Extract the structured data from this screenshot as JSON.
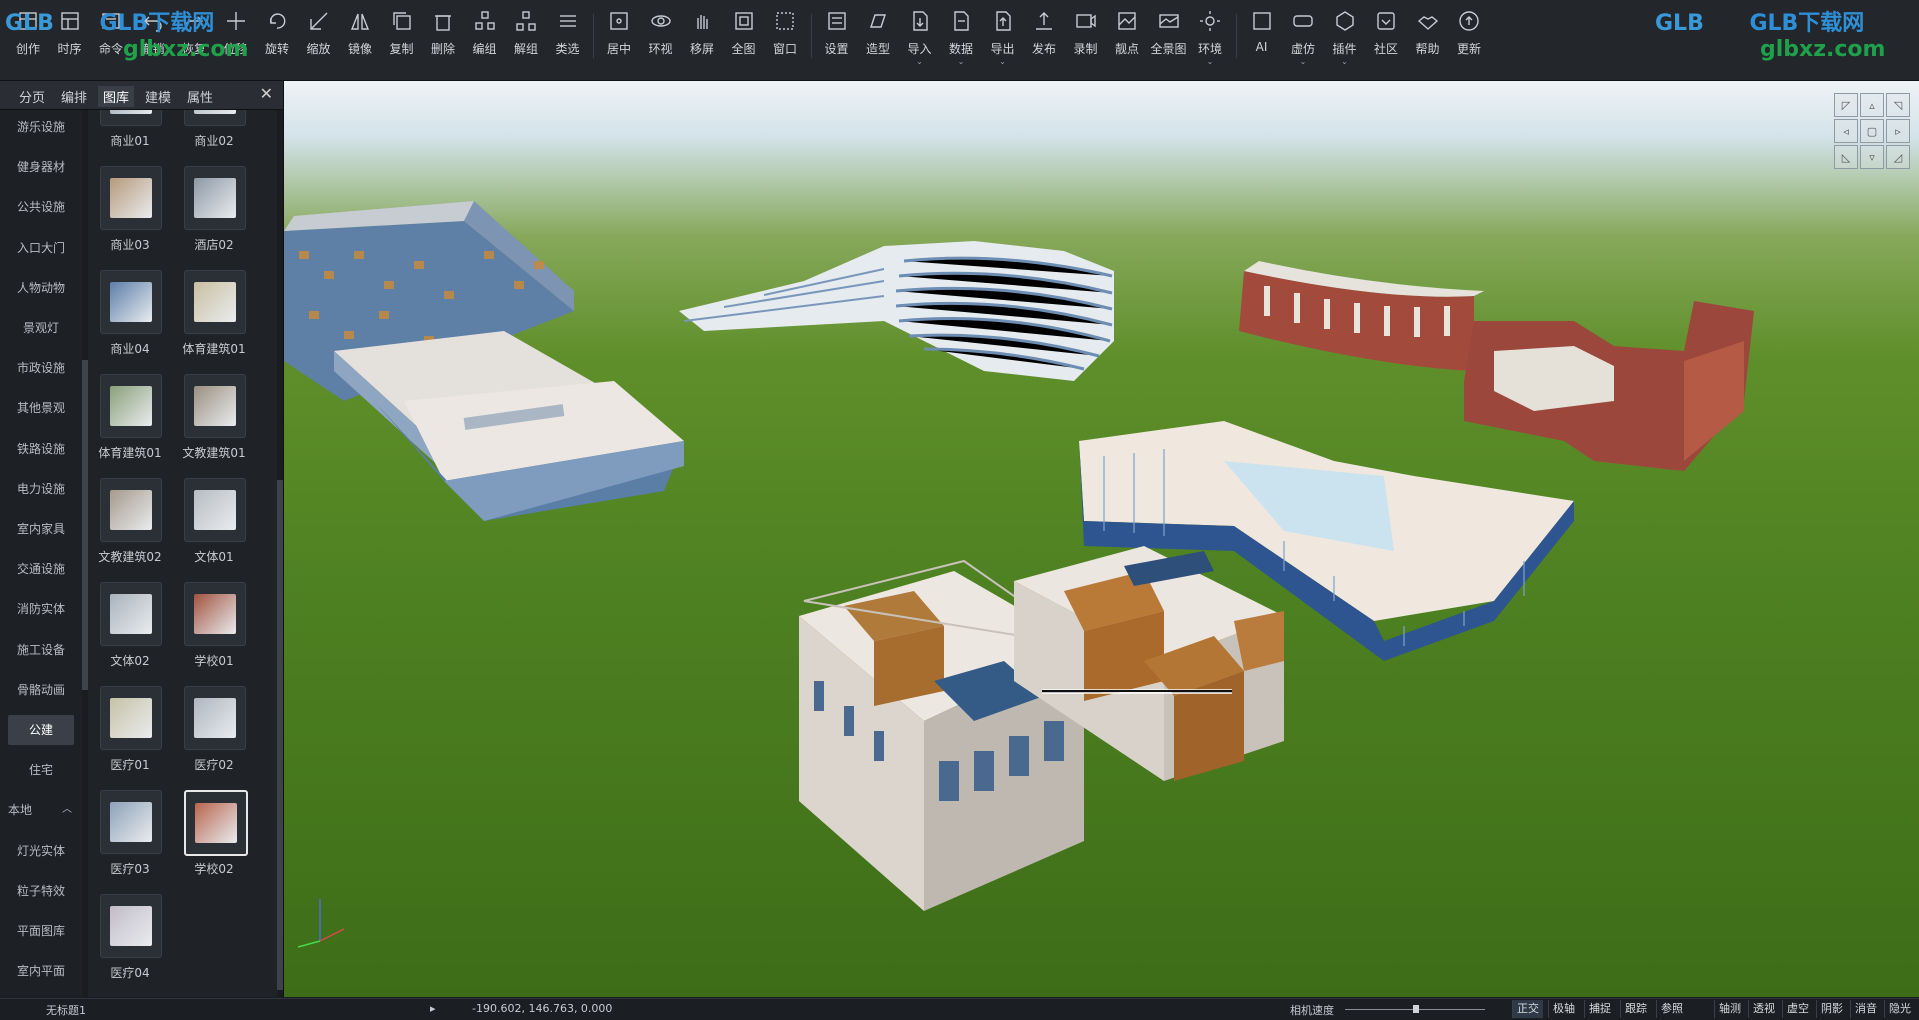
{
  "toolbar": {
    "tools": [
      {
        "label": "创作",
        "icon": "create-icon"
      },
      {
        "label": "时序",
        "icon": "timeline-icon"
      },
      {
        "label": "命令",
        "icon": "command-icon"
      },
      {
        "label": "撤销",
        "icon": "undo-icon"
      },
      {
        "label": "恢复",
        "icon": "redo-icon"
      },
      {
        "label": "位移",
        "icon": "move-icon"
      },
      {
        "label": "旋转",
        "icon": "rotate-icon"
      },
      {
        "label": "缩放",
        "icon": "scale-icon"
      },
      {
        "label": "镜像",
        "icon": "mirror-icon"
      },
      {
        "label": "复制",
        "icon": "copy-icon"
      },
      {
        "label": "删除",
        "icon": "delete-icon"
      },
      {
        "label": "编组",
        "icon": "group-icon"
      },
      {
        "label": "解组",
        "icon": "ungroup-icon"
      },
      {
        "label": "类选",
        "icon": "select-type-icon"
      },
      {
        "label": "居中",
        "icon": "center-icon"
      },
      {
        "label": "环视",
        "icon": "orbit-icon"
      },
      {
        "label": "移屏",
        "icon": "pan-hand-icon"
      },
      {
        "label": "全图",
        "icon": "fit-all-icon"
      },
      {
        "label": "窗口",
        "icon": "window-zoom-icon"
      },
      {
        "label": "设置",
        "icon": "settings-icon"
      },
      {
        "label": "造型",
        "icon": "modeling-icon"
      },
      {
        "label": "导入",
        "icon": "import-icon",
        "dropdown": true
      },
      {
        "label": "数据",
        "icon": "data-icon",
        "dropdown": true
      },
      {
        "label": "导出",
        "icon": "export-icon",
        "dropdown": true
      },
      {
        "label": "发布",
        "icon": "publish-icon"
      },
      {
        "label": "录制",
        "icon": "record-icon"
      },
      {
        "label": "靓点",
        "icon": "highlight-icon"
      },
      {
        "label": "全景图",
        "icon": "panorama-icon"
      },
      {
        "label": "环境",
        "icon": "environment-icon",
        "dropdown": true
      },
      {
        "label": "AI",
        "icon": "ai-icon"
      },
      {
        "label": "虚仿",
        "icon": "vr-icon",
        "dropdown": true
      },
      {
        "label": "插件",
        "icon": "plugin-icon",
        "dropdown": true
      },
      {
        "label": "社区",
        "icon": "community-icon"
      },
      {
        "label": "帮助",
        "icon": "help-icon"
      },
      {
        "label": "更新",
        "icon": "update-icon"
      }
    ]
  },
  "watermark": {
    "brand": "GLB下载网",
    "url": "glbxz.com",
    "logo": "GLB"
  },
  "panel": {
    "tabs": [
      "分页",
      "编排",
      "图库",
      "建模",
      "属性"
    ],
    "active_tab": "图库",
    "categories": [
      "游乐设施",
      "健身器材",
      "公共设施",
      "入口大门",
      "人物动物",
      "景观灯",
      "市政设施",
      "其他景观",
      "铁路设施",
      "电力设施",
      "室内家具",
      "交通设施",
      "消防实体",
      "施工设备",
      "骨骼动画",
      "公建",
      "住宅"
    ],
    "active_category": "公建",
    "local_group": "本地",
    "local_items": [
      "灯光实体",
      "粒子特效",
      "平面图库",
      "室内平面"
    ],
    "library_items": [
      {
        "label": "商业01",
        "color": "#7f8fa0"
      },
      {
        "label": "商业02",
        "color": "#9aa7b5"
      },
      {
        "label": "商业03",
        "color": "#b69a7c"
      },
      {
        "label": "酒店02",
        "color": "#8d98a6"
      },
      {
        "label": "商业04",
        "color": "#5d7ea8"
      },
      {
        "label": "体育建筑01",
        "color": "#c9c0a0"
      },
      {
        "label": "体育建筑01",
        "color": "#8aa07a"
      },
      {
        "label": "文教建筑01",
        "color": "#9a8f80"
      },
      {
        "label": "文教建筑02",
        "color": "#a59a8c"
      },
      {
        "label": "文体01",
        "color": "#b7bcc2"
      },
      {
        "label": "文体02",
        "color": "#a9b3bd"
      },
      {
        "label": "学校01",
        "color": "#a2533f"
      },
      {
        "label": "医疗01",
        "color": "#c6c2a6"
      },
      {
        "label": "医疗02",
        "color": "#aeb6c0"
      },
      {
        "label": "医疗03",
        "color": "#8ea2b8"
      },
      {
        "label": "学校02",
        "color": "#b8664e"
      },
      {
        "label": "医疗04",
        "color": "#c2bcc8"
      }
    ],
    "selected_item": "学校02"
  },
  "status": {
    "doc_name": "无标题1",
    "coords": "-190.602, 146.763, 0.000",
    "camera_speed_label": "相机速度",
    "toggles": [
      "正交",
      "极轴",
      "捕捉",
      "跟踪",
      "参照"
    ],
    "right_toggles": [
      "轴测",
      "透视",
      "虚空",
      "阴影",
      "消音",
      "隐光"
    ]
  },
  "colors": {
    "accent": "#3b4048",
    "toolbar_bg": "#23262b",
    "panel_bg": "#1f2227"
  }
}
